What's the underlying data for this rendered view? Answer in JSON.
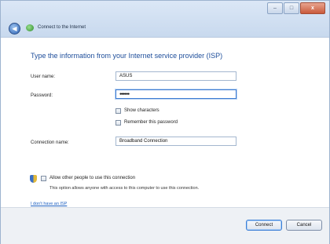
{
  "window": {
    "title": "Connect to the Internet",
    "controls": {
      "minimize": "–",
      "maximize": "□",
      "close": "x"
    }
  },
  "form": {
    "heading": "Type the information from your Internet service provider (ISP)",
    "username": {
      "label": "User name:",
      "value": "ASUS"
    },
    "password": {
      "label": "Password:",
      "value": "●●●●●●"
    },
    "show_characters": {
      "label": "Show characters",
      "checked": false
    },
    "remember_password": {
      "label": "Remember this password",
      "checked": false
    },
    "connection_name": {
      "label": "Connection name:",
      "value": "Broadband Connection"
    },
    "allow_others": {
      "label": "Allow other people to use this connection",
      "description": "This option allows anyone with access to this computer to use this connection.",
      "checked": false
    },
    "isp_link": "I don't have an ISP"
  },
  "buttons": {
    "connect": "Connect",
    "cancel": "Cancel"
  },
  "icons": {
    "back": "back-arrow-icon",
    "network": "network-globe-icon",
    "shield": "uac-shield-icon"
  }
}
